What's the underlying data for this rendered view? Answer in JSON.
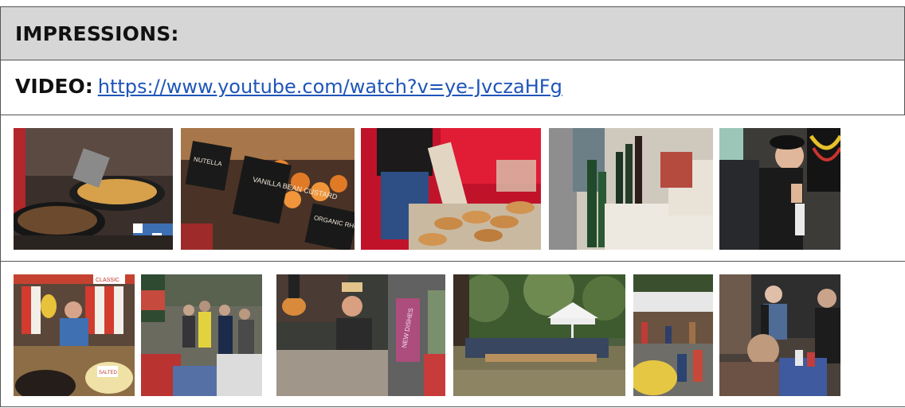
{
  "header": {
    "title": "IMPRESSIONS:"
  },
  "video": {
    "label": "VIDEO:",
    "url": "https://www.youtube.com/watch?v=ye-JvczaHFg"
  },
  "gallery": {
    "row1": [
      {
        "name": "photo-pans-cooking"
      },
      {
        "name": "photo-pastry-display-signs",
        "signs": [
          "VANILLA BEAN CUSTARD",
          "ORGANIC RHUBARB & CUSTARD",
          "NUTELLA"
        ]
      },
      {
        "name": "photo-bread-stall"
      },
      {
        "name": "photo-wine-tasting"
      },
      {
        "name": "photo-bartender-cap"
      }
    ],
    "row2": [
      {
        "name": "photo-popcorn-stand",
        "signs": [
          "CLASSIC",
          "SALTED"
        ]
      },
      {
        "name": "photo-market-crowd"
      },
      {
        "name": "photo-food-truck-woman",
        "signs": [
          "NEW DISHES"
        ]
      },
      {
        "name": "photo-park-tent-crowd"
      },
      {
        "name": "photo-market-street-stalls"
      },
      {
        "name": "photo-speaker-conversation"
      }
    ]
  }
}
